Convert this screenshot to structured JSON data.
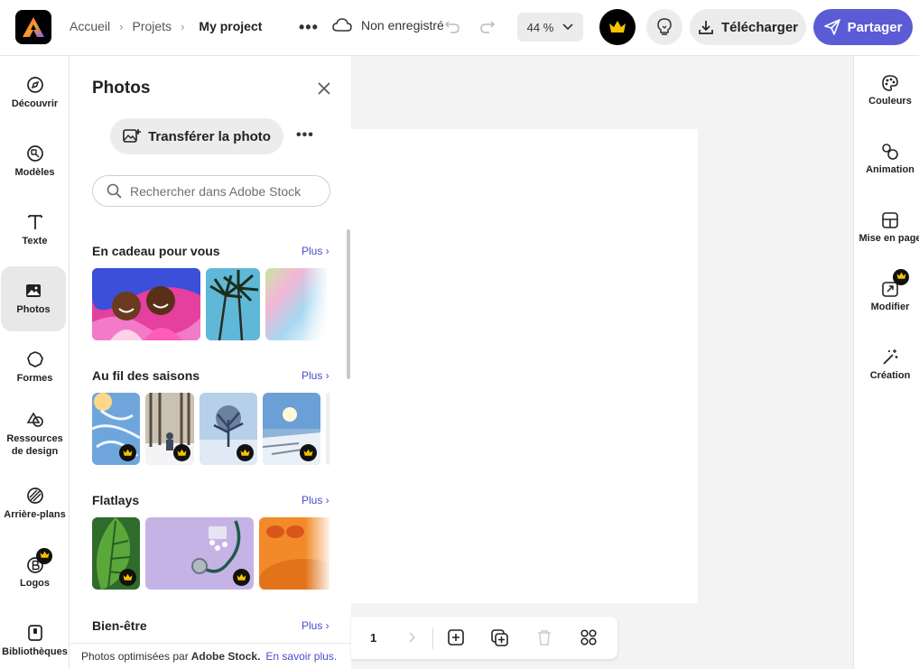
{
  "breadcrumb": {
    "home": "Accueil",
    "projects": "Projets",
    "current": "My project"
  },
  "header": {
    "save_status": "Non enregistré",
    "zoom": "44 %",
    "download_label": "Télécharger",
    "share_label": "Partager"
  },
  "left_rail": {
    "items": [
      {
        "label": "Découvrir",
        "icon": "compass-icon"
      },
      {
        "label": "Modèles",
        "icon": "templates-icon"
      },
      {
        "label": "Texte",
        "icon": "text-icon"
      },
      {
        "label": "Photos",
        "icon": "photo-icon"
      },
      {
        "label": "Formes",
        "icon": "shapes-icon"
      },
      {
        "label": "Ressources de design",
        "icon": "design-assets-icon"
      },
      {
        "label": "Arrière-plans",
        "icon": "backgrounds-icon"
      },
      {
        "label": "Logos",
        "icon": "logo-icon"
      },
      {
        "label": "Bibliothèques",
        "icon": "library-icon"
      }
    ]
  },
  "panel": {
    "title": "Photos",
    "upload_label": "Transférer la photo",
    "search_placeholder": "Rechercher dans Adobe Stock",
    "sections": [
      {
        "title": "En cadeau pour vous",
        "more": "Plus ›"
      },
      {
        "title": "Au fil des saisons",
        "more": "Plus ›"
      },
      {
        "title": "Flatlays",
        "more": "Plus ›"
      },
      {
        "title": "Bien-être",
        "more": "Plus ›"
      }
    ],
    "footer": {
      "prefix": "Photos optimisées par",
      "brand": "Adobe Stock.",
      "link": "En savoir plus."
    }
  },
  "page_bar": {
    "page_number": "1"
  },
  "right_rail": {
    "items": [
      {
        "label": "Couleurs",
        "icon": "palette-icon"
      },
      {
        "label": "Animation",
        "icon": "animation-icon"
      },
      {
        "label": "Mise en page",
        "icon": "layout-icon"
      },
      {
        "label": "Modifier",
        "icon": "resize-icon"
      },
      {
        "label": "Création",
        "icon": "magic-wand-icon"
      }
    ]
  },
  "colors": {
    "accent": "#5b5bd6",
    "link": "#4a4ad0",
    "premium": "#f5c400"
  }
}
